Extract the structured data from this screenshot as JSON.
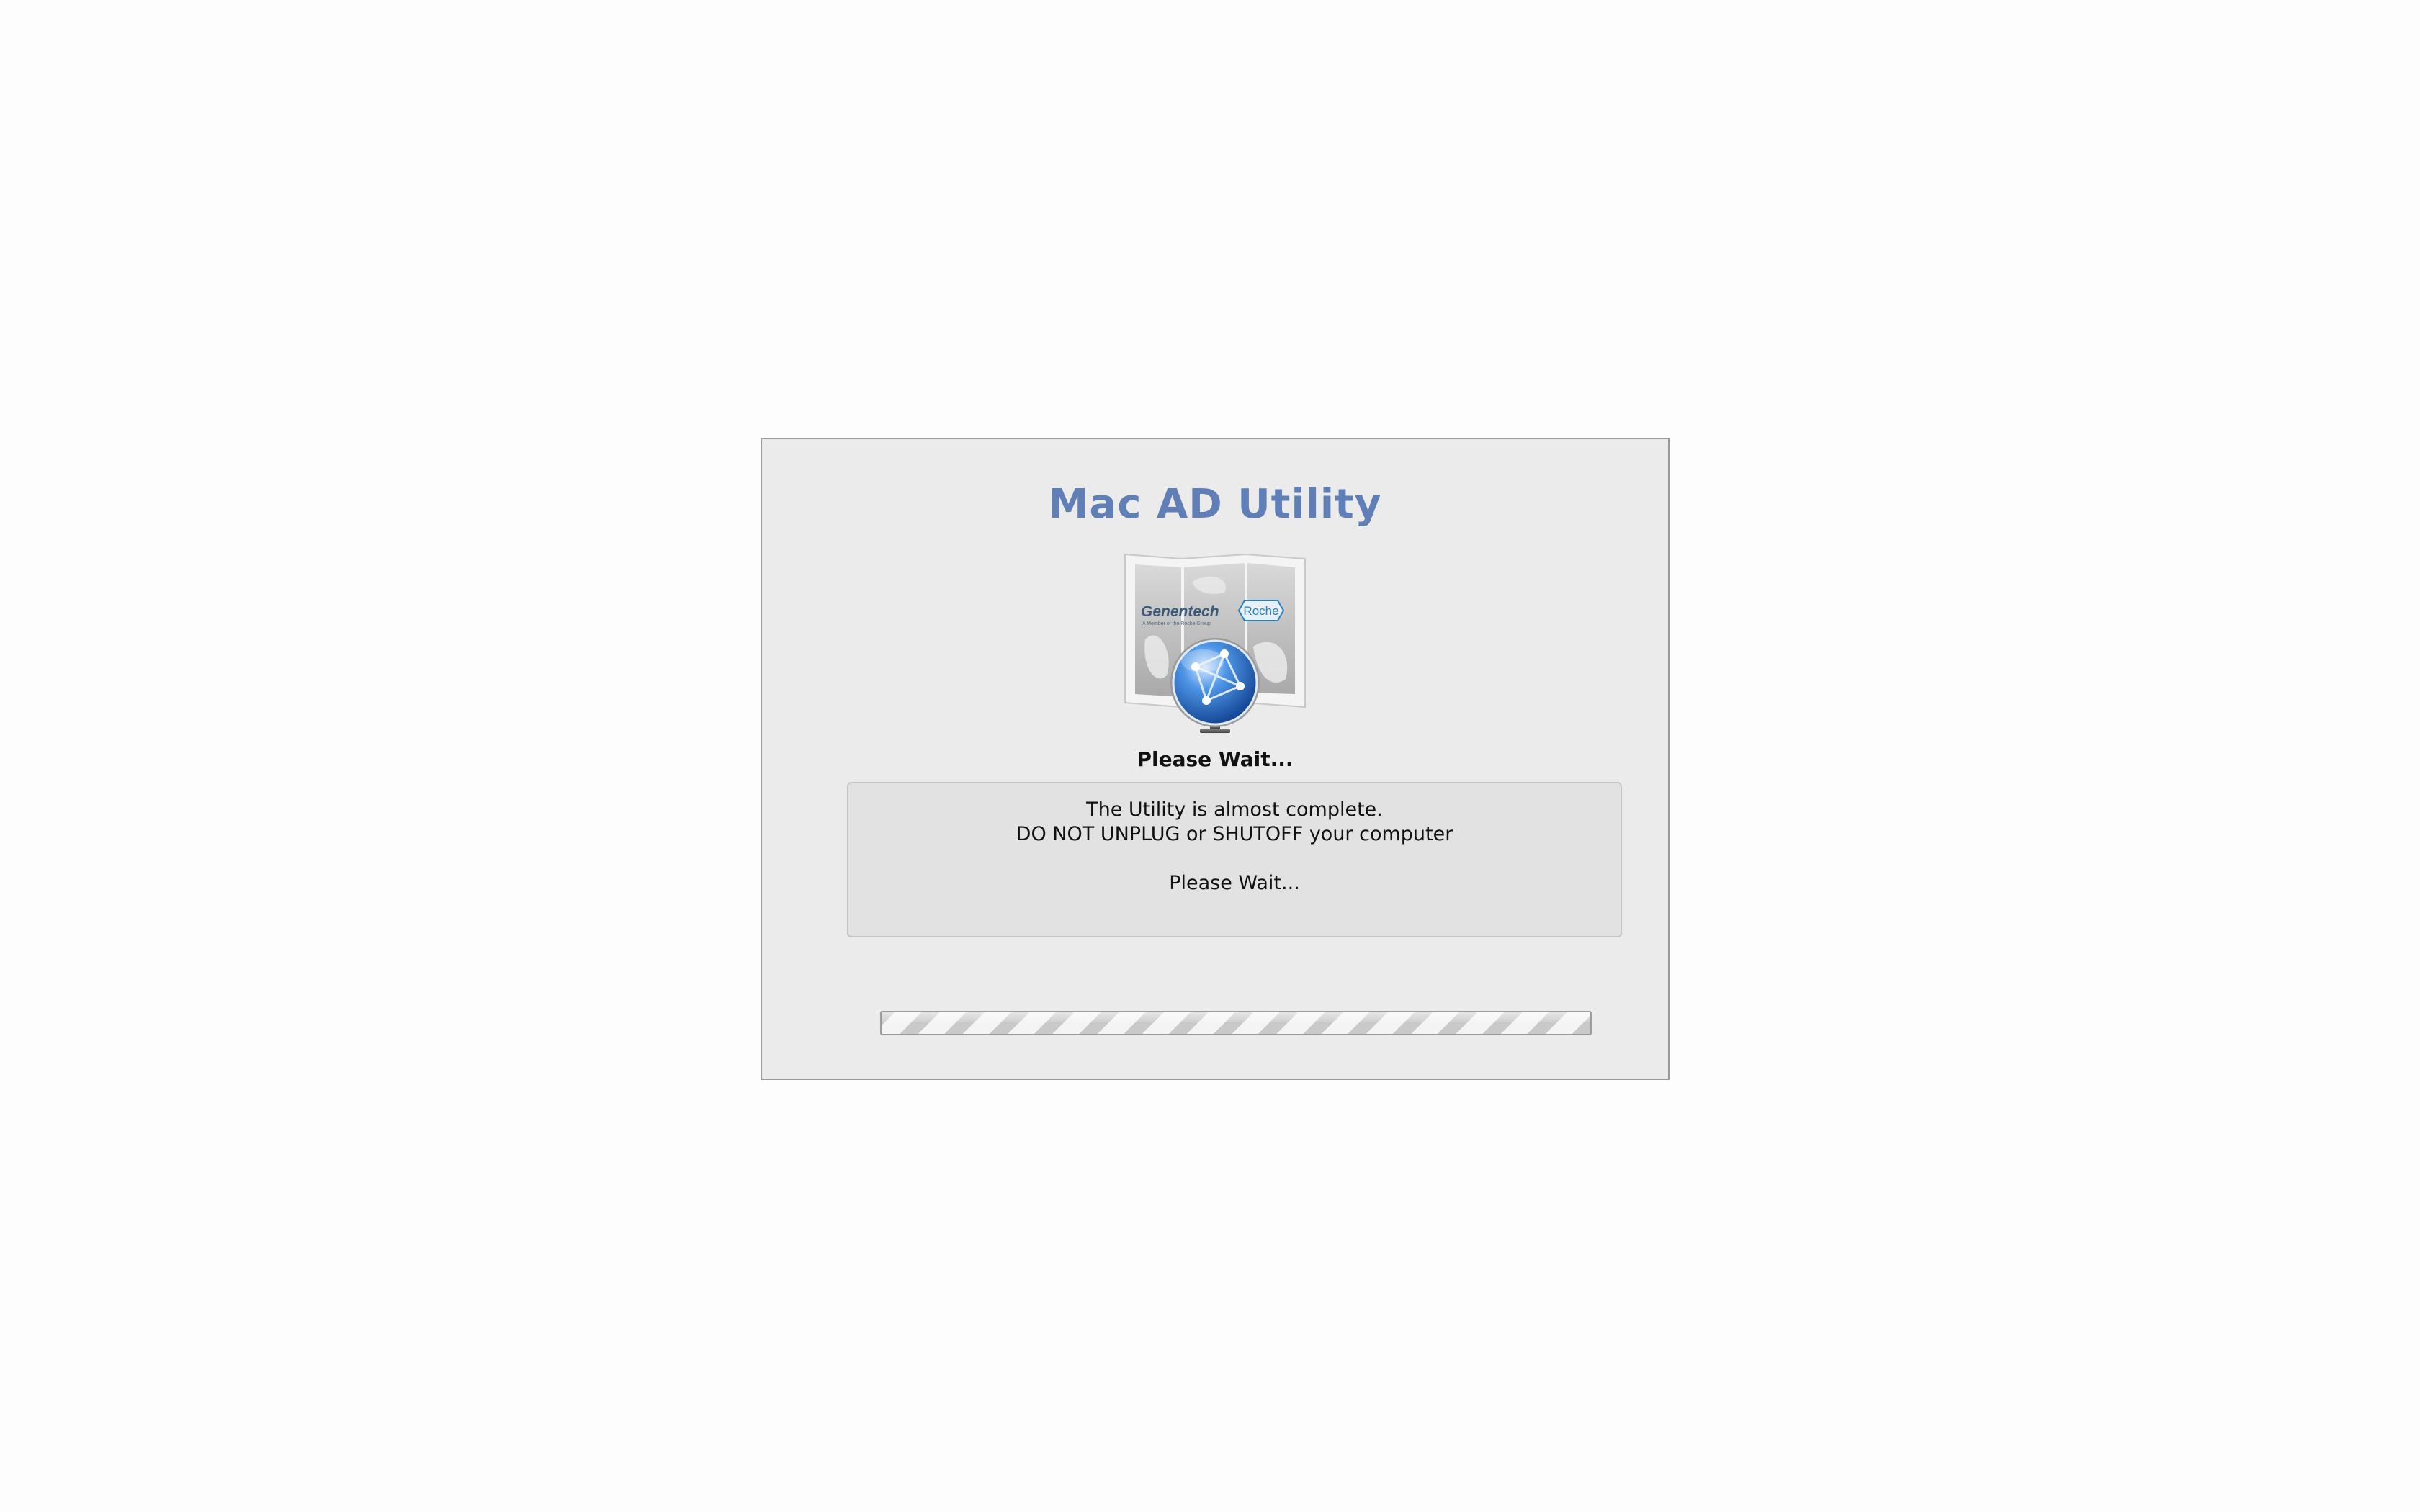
{
  "dialog": {
    "title": "Mac AD Utility",
    "logo": {
      "icon": "network-globe-map-icon",
      "brand_left": "Genentech",
      "brand_right": "Roche"
    },
    "status_heading": "Please Wait...",
    "message": {
      "line1": "The Utility is almost complete.",
      "line2": "DO NOT UNPLUG or SHUTOFF your computer",
      "line3": "Please Wait..."
    },
    "progress": {
      "state": "indeterminate"
    }
  },
  "colors": {
    "title": "#5f7fb6",
    "dialog_background": "#ebebeb",
    "page_background": "#fdfdfd"
  }
}
